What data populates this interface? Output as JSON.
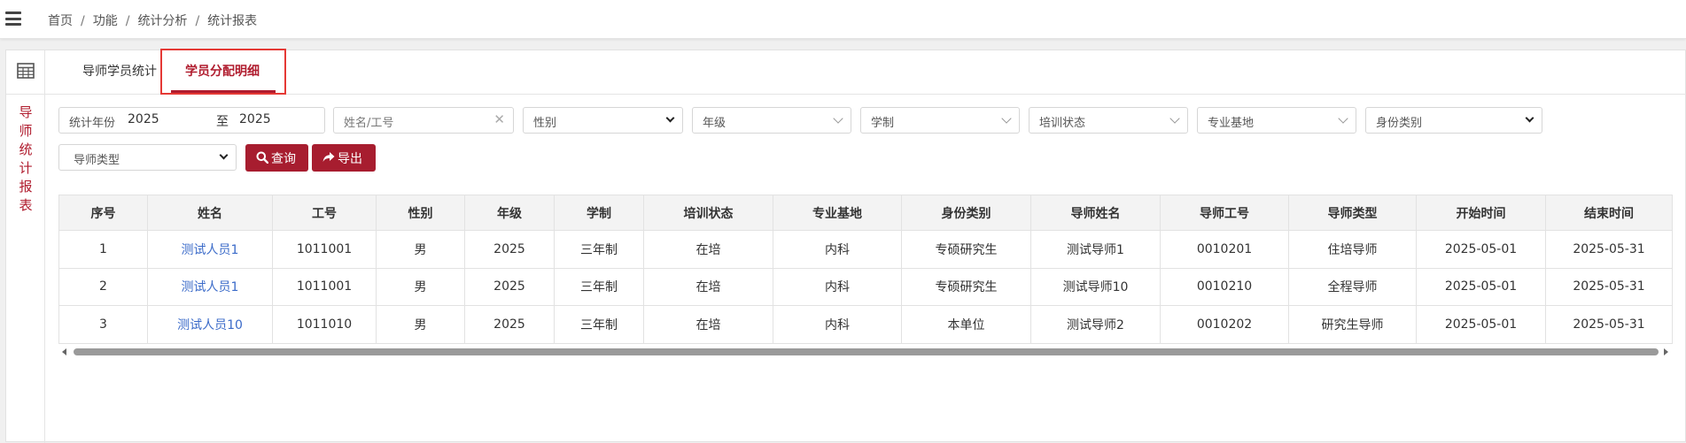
{
  "breadcrumb": [
    "首页",
    "功能",
    "统计分析",
    "统计报表"
  ],
  "sidebar_title_chars": [
    "导",
    "师",
    "统",
    "计",
    "报",
    "表"
  ],
  "tabs": [
    {
      "label": "导师学员统计",
      "active": false
    },
    {
      "label": "学员分配明细",
      "active": true
    }
  ],
  "filters": {
    "year_label": "统计年份",
    "year_from": "2025",
    "year_to_label": "至",
    "year_to": "2025",
    "name_placeholder": "姓名/工号",
    "gender": "性别",
    "grade": "年级",
    "program": "学制",
    "training_status": "培训状态",
    "base": "专业基地",
    "identity": "身份类别",
    "tutor_type": "导师类型"
  },
  "buttons": {
    "query": "查询",
    "export": "导出"
  },
  "colors": {
    "accent": "#a71d2f",
    "link": "#3b6bc9"
  },
  "table": {
    "columns": [
      "序号",
      "姓名",
      "工号",
      "性别",
      "年级",
      "学制",
      "培训状态",
      "专业基地",
      "身份类别",
      "导师姓名",
      "导师工号",
      "导师类型",
      "开始时间",
      "结束时间"
    ],
    "rows": [
      [
        "1",
        "测试人员1",
        "1011001",
        "男",
        "2025",
        "三年制",
        "在培",
        "内科",
        "专硕研究生",
        "测试导师1",
        "0010201",
        "住培导师",
        "2025-05-01",
        "2025-05-31"
      ],
      [
        "2",
        "测试人员1",
        "1011001",
        "男",
        "2025",
        "三年制",
        "在培",
        "内科",
        "专硕研究生",
        "测试导师10",
        "0010210",
        "全程导师",
        "2025-05-01",
        "2025-05-31"
      ],
      [
        "3",
        "测试人员10",
        "1011010",
        "男",
        "2025",
        "三年制",
        "在培",
        "内科",
        "本单位",
        "测试导师2",
        "0010202",
        "研究生导师",
        "2025-05-01",
        "2025-05-31"
      ]
    ]
  }
}
